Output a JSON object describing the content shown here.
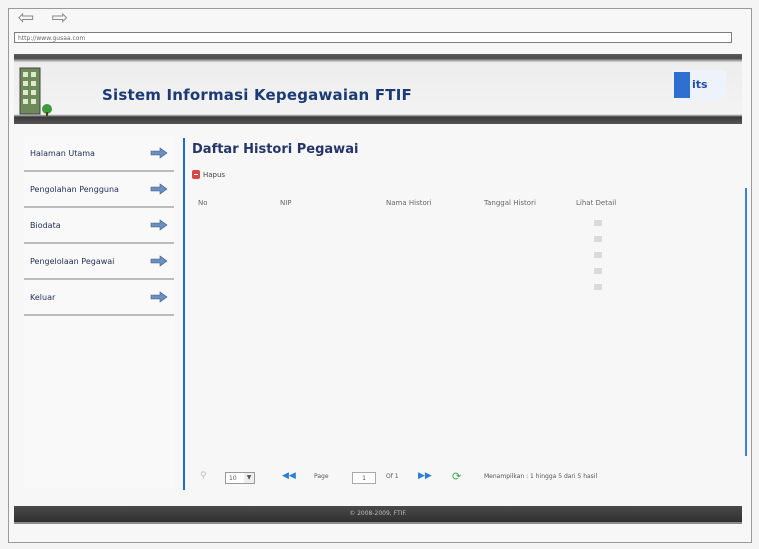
{
  "browser": {
    "url": "http://www.gusaa.com"
  },
  "header": {
    "title": "Sistem Informasi Kepegawaian FTIF",
    "logo_text": "its"
  },
  "sidebar": {
    "items": [
      {
        "label": "Halaman Utama"
      },
      {
        "label": "Pengolahan Pengguna"
      },
      {
        "label": "Biodata"
      },
      {
        "label": "Pengelolaan Pegawai"
      },
      {
        "label": "Keluar"
      }
    ]
  },
  "main": {
    "title": "Daftar Histori Pegawai",
    "delete_label": "Hapus",
    "columns": [
      "No",
      "NIP",
      "Nama Histori",
      "Tanggal Histori",
      "Lihat Detail"
    ],
    "row_count": 5
  },
  "pager": {
    "per_page": "10",
    "page_label": "Page",
    "page_value": "1",
    "of_label": "Of 1",
    "summary": "Menampilkan : 1 hingga 5 dari 5 hasil"
  },
  "footer": {
    "text": "© 2008-2009, FTIF."
  },
  "colors": {
    "accent": "#1f6bd1",
    "title": "#25356a",
    "footer_bg": "#3a3a3a"
  }
}
